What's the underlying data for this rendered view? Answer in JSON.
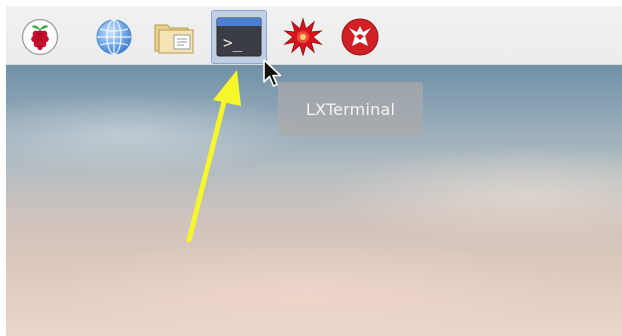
{
  "taskbar": {
    "launchers": [
      {
        "icon": "raspberry-pi-menu-icon"
      },
      {
        "icon": "web-browser-globe-icon"
      },
      {
        "icon": "file-manager-folder-icon"
      },
      {
        "icon": "terminal-icon",
        "state": "hovered"
      },
      {
        "icon": "starburst-app-icon"
      },
      {
        "icon": "wolfram-icon"
      }
    ]
  },
  "tooltip": {
    "text": "LXTerminal"
  },
  "terminal_icon": {
    "prompt_text": ">_"
  },
  "annotation": {
    "arrow_color": "#f6f62a"
  },
  "colors": {
    "panel_bg": "#efefef",
    "raspberry_red": "#c8102e",
    "terminal_blue": "#4a7fd4",
    "wolfram_red": "#d11f26"
  }
}
